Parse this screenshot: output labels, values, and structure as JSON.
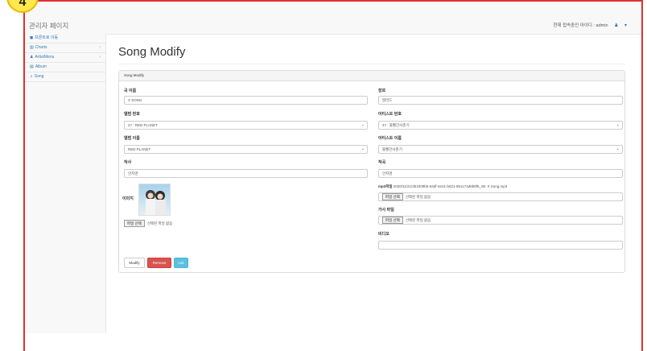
{
  "step_badge": "4",
  "topbar": {
    "brand": "관리자 페이지",
    "user_text": "현재 접속중인 아이디 : admin",
    "user_menu": "▾"
  },
  "sidebar": {
    "items": [
      {
        "icon": "home-icon",
        "glyph": "◼",
        "label": "프론트로 이동",
        "has_arrow": false
      },
      {
        "icon": "chart-icon",
        "glyph": "▥",
        "label": "Charts",
        "has_arrow": true
      },
      {
        "icon": "user-icon",
        "glyph": "♟",
        "label": "ArtistMenu",
        "has_arrow": true
      },
      {
        "icon": "book-icon",
        "glyph": "▤",
        "label": "Album",
        "has_arrow": false
      },
      {
        "icon": "music-icon",
        "glyph": "♫",
        "label": "Song",
        "has_arrow": false
      }
    ],
    "arrow_glyph": "‹"
  },
  "main": {
    "title": "Song Modify",
    "panel_heading": "Song Modify"
  },
  "form": {
    "song_name_label": "곡 이름",
    "song_name_value": "X SONG",
    "genre_label": "장르",
    "genre_value": "발라드",
    "album_no_label": "앨범 번호",
    "album_no_value": "47 : RED PLANET",
    "artist_no_label": "아티스트 번호",
    "artist_no_value": "47 : 볼빨간사춘기",
    "album_name_label": "앨범 이름",
    "album_name_value": "RED PLANET",
    "artist_name_label": "아티스트 이름",
    "artist_name_value": "볼빨간사춘기",
    "lyricist_label": "작사",
    "lyricist_value": "안지영",
    "composer_label": "작곡",
    "composer_value": "안지영",
    "image_label": "이미지",
    "mp3_label": "mp3파일",
    "mp3_value": "2020/11/21/3b1009bb-63df-4e21-b621-861174d8b8f5_08. X Song.mp3",
    "lyrics_file_label": "가사 파일",
    "video_label": "비디오",
    "video_value": "",
    "file_button": "파일 선택",
    "no_file_selected_1": "선택된 파일 없음",
    "no_file_selected_2": "선택된 파일 없음",
    "no_file_selected_3": "선택된 파일 없음"
  },
  "buttons": {
    "modify": "Modify",
    "remove": "Remove",
    "list": "List"
  },
  "colors": {
    "frame_border": "#e03030",
    "badge": "#ffe94d",
    "link": "#337ab7",
    "danger": "#d9534f",
    "info": "#5bc0de"
  }
}
